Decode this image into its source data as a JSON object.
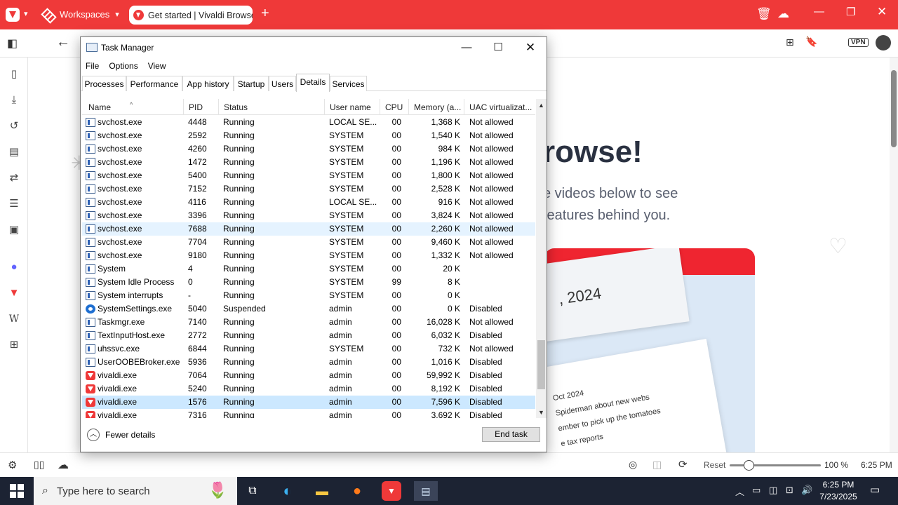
{
  "browser": {
    "workspaces_label": "Workspaces",
    "tab_title": "Get started | Vivaldi Browser",
    "status": {
      "reset_label": "Reset",
      "zoom": "100 %",
      "time": "6:25 PM"
    },
    "addr_vpn": "VPN"
  },
  "webpage": {
    "title_fragment": "rowse!",
    "sub1": "e videos below to see",
    "sub2": "features behind you.",
    "card_date": ", 2024",
    "card_lines": [
      "Oct 2024",
      "Spiderman about new webs",
      "ember to pick up the tomatoes",
      "e tax reports"
    ]
  },
  "taskmanager": {
    "title": "Task Manager",
    "menu": [
      "File",
      "Options",
      "View"
    ],
    "tabs": [
      "Processes",
      "Performance",
      "App history",
      "Startup",
      "Users",
      "Details",
      "Services"
    ],
    "active_tab": "Details",
    "columns": [
      "Name",
      "PID",
      "Status",
      "User name",
      "CPU",
      "Memory (a...",
      "UAC virtualizat..."
    ],
    "rows": [
      {
        "name": "svchost.exe",
        "pid": "4448",
        "status": "Running",
        "user": "LOCAL SE...",
        "cpu": "00",
        "mem": "1,368 K",
        "uac": "Not allowed",
        "icon": "svc"
      },
      {
        "name": "svchost.exe",
        "pid": "2592",
        "status": "Running",
        "user": "SYSTEM",
        "cpu": "00",
        "mem": "1,540 K",
        "uac": "Not allowed",
        "icon": "svc"
      },
      {
        "name": "svchost.exe",
        "pid": "4260",
        "status": "Running",
        "user": "SYSTEM",
        "cpu": "00",
        "mem": "984 K",
        "uac": "Not allowed",
        "icon": "svc"
      },
      {
        "name": "svchost.exe",
        "pid": "1472",
        "status": "Running",
        "user": "SYSTEM",
        "cpu": "00",
        "mem": "1,196 K",
        "uac": "Not allowed",
        "icon": "svc"
      },
      {
        "name": "svchost.exe",
        "pid": "5400",
        "status": "Running",
        "user": "SYSTEM",
        "cpu": "00",
        "mem": "1,800 K",
        "uac": "Not allowed",
        "icon": "svc"
      },
      {
        "name": "svchost.exe",
        "pid": "7152",
        "status": "Running",
        "user": "SYSTEM",
        "cpu": "00",
        "mem": "2,528 K",
        "uac": "Not allowed",
        "icon": "svc"
      },
      {
        "name": "svchost.exe",
        "pid": "4116",
        "status": "Running",
        "user": "LOCAL SE...",
        "cpu": "00",
        "mem": "916 K",
        "uac": "Not allowed",
        "icon": "svc"
      },
      {
        "name": "svchost.exe",
        "pid": "3396",
        "status": "Running",
        "user": "SYSTEM",
        "cpu": "00",
        "mem": "3,824 K",
        "uac": "Not allowed",
        "icon": "svc"
      },
      {
        "name": "svchost.exe",
        "pid": "7688",
        "status": "Running",
        "user": "SYSTEM",
        "cpu": "00",
        "mem": "2,260 K",
        "uac": "Not allowed",
        "icon": "svc",
        "hover": true
      },
      {
        "name": "svchost.exe",
        "pid": "7704",
        "status": "Running",
        "user": "SYSTEM",
        "cpu": "00",
        "mem": "9,460 K",
        "uac": "Not allowed",
        "icon": "svc"
      },
      {
        "name": "svchost.exe",
        "pid": "9180",
        "status": "Running",
        "user": "SYSTEM",
        "cpu": "00",
        "mem": "1,332 K",
        "uac": "Not allowed",
        "icon": "svc"
      },
      {
        "name": "System",
        "pid": "4",
        "status": "Running",
        "user": "SYSTEM",
        "cpu": "00",
        "mem": "20 K",
        "uac": "",
        "icon": "svc"
      },
      {
        "name": "System Idle Process",
        "pid": "0",
        "status": "Running",
        "user": "SYSTEM",
        "cpu": "99",
        "mem": "8 K",
        "uac": "",
        "icon": "svc"
      },
      {
        "name": "System interrupts",
        "pid": "-",
        "status": "Running",
        "user": "SYSTEM",
        "cpu": "00",
        "mem": "0 K",
        "uac": "",
        "icon": "svc"
      },
      {
        "name": "SystemSettings.exe",
        "pid": "5040",
        "status": "Suspended",
        "user": "admin",
        "cpu": "00",
        "mem": "0 K",
        "uac": "Disabled",
        "icon": "gear"
      },
      {
        "name": "Taskmgr.exe",
        "pid": "7140",
        "status": "Running",
        "user": "admin",
        "cpu": "00",
        "mem": "16,028 K",
        "uac": "Not allowed",
        "icon": "svc"
      },
      {
        "name": "TextInputHost.exe",
        "pid": "2772",
        "status": "Running",
        "user": "admin",
        "cpu": "00",
        "mem": "6,032 K",
        "uac": "Disabled",
        "icon": "svc"
      },
      {
        "name": "uhssvc.exe",
        "pid": "6844",
        "status": "Running",
        "user": "SYSTEM",
        "cpu": "00",
        "mem": "732 K",
        "uac": "Not allowed",
        "icon": "svc"
      },
      {
        "name": "UserOOBEBroker.exe",
        "pid": "5936",
        "status": "Running",
        "user": "admin",
        "cpu": "00",
        "mem": "1,016 K",
        "uac": "Disabled",
        "icon": "svc"
      },
      {
        "name": "vivaldi.exe",
        "pid": "7064",
        "status": "Running",
        "user": "admin",
        "cpu": "00",
        "mem": "59,992 K",
        "uac": "Disabled",
        "icon": "viv"
      },
      {
        "name": "vivaldi.exe",
        "pid": "5240",
        "status": "Running",
        "user": "admin",
        "cpu": "00",
        "mem": "8,192 K",
        "uac": "Disabled",
        "icon": "viv"
      },
      {
        "name": "vivaldi.exe",
        "pid": "1576",
        "status": "Running",
        "user": "admin",
        "cpu": "00",
        "mem": "7,596 K",
        "uac": "Disabled",
        "icon": "viv",
        "selected": true
      },
      {
        "name": "vivaldi.exe",
        "pid": "7316",
        "status": "Running",
        "user": "admin",
        "cpu": "00",
        "mem": "3,692 K",
        "uac": "Disabled",
        "icon": "viv"
      }
    ],
    "fewer_details": "Fewer details",
    "end_task": "End task"
  },
  "taskbar": {
    "search_placeholder": "Type here to search",
    "time": "6:25 PM",
    "date": "7/23/2025"
  }
}
